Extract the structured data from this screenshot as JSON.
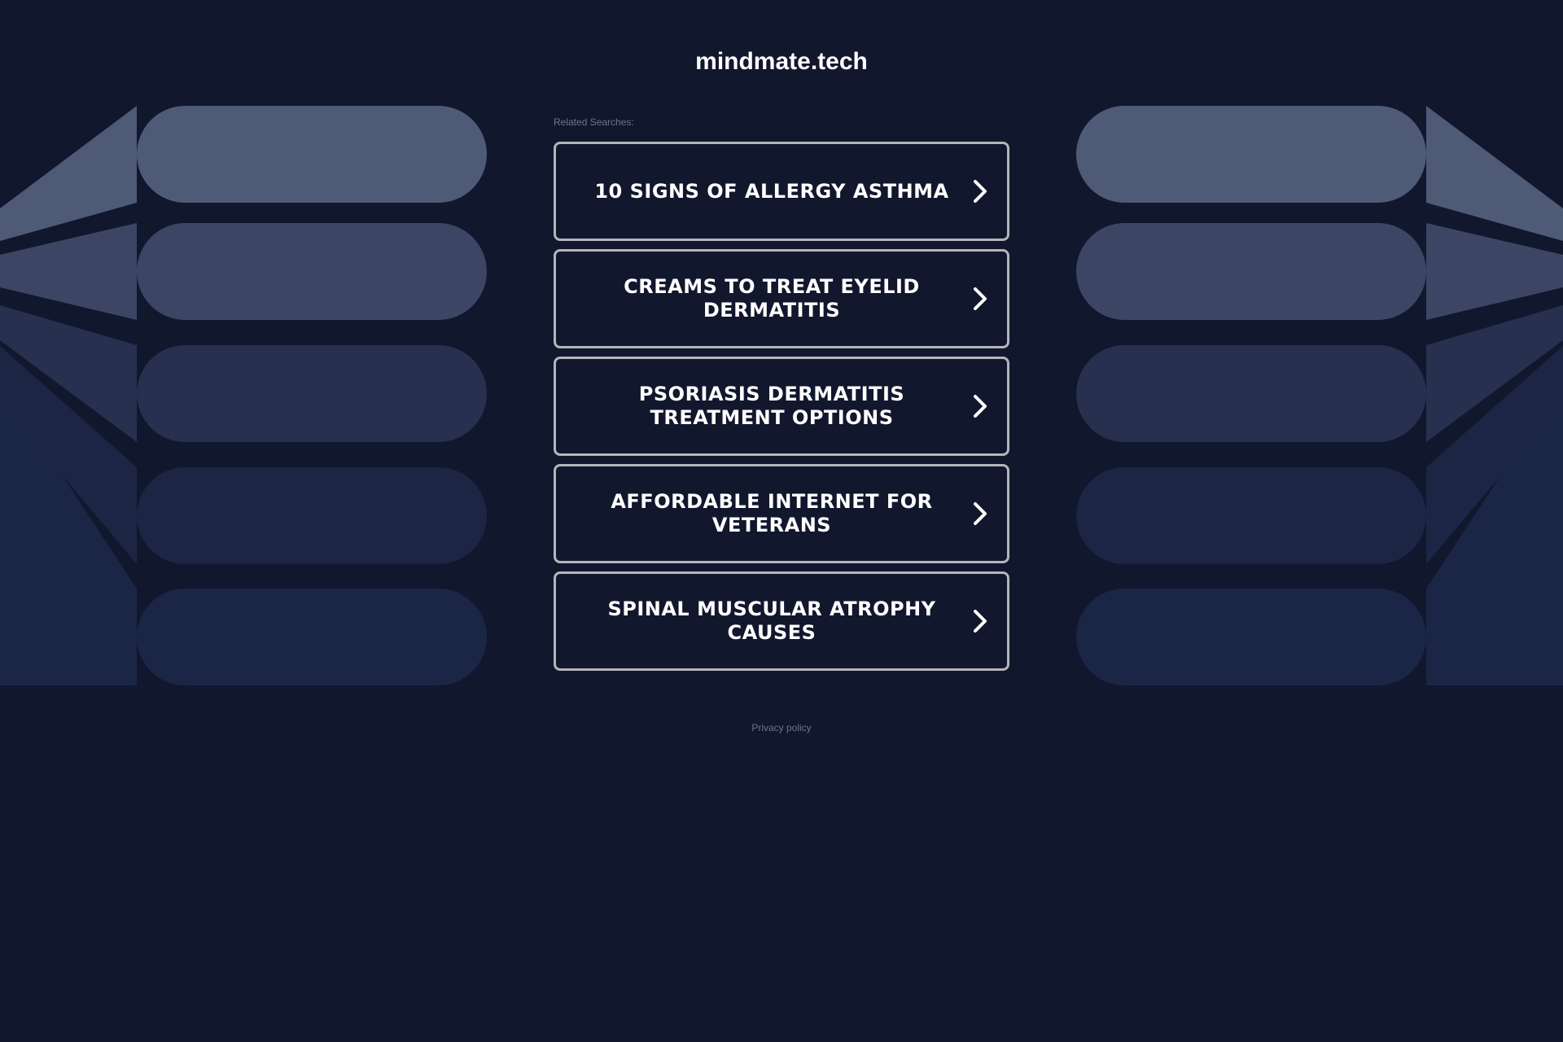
{
  "site": {
    "domain": "mindmate.tech"
  },
  "related": {
    "label": "Related Searches:",
    "items": [
      {
        "label": "10 SIGNS OF ALLERGY ASTHMA"
      },
      {
        "label": "CREAMS TO TREAT EYELID DERMATITIS"
      },
      {
        "label": "PSORIASIS DERMATITIS TREATMENT OPTIONS"
      },
      {
        "label": "AFFORDABLE INTERNET FOR VETERANS"
      },
      {
        "label": "SPINAL MUSCULAR ATROPHY CAUSES"
      }
    ]
  },
  "footer": {
    "privacy_label": "Privacy policy"
  },
  "icons": {
    "link_arrow": "chevron-right-icon"
  },
  "colors": {
    "background": "#11172d",
    "card_border": "#b3b5bb",
    "text": "#ffffff",
    "muted_text": "#6a7594",
    "band_1": "#4f5a77",
    "band_2": "#3c4664",
    "band_3": "#28304f",
    "band_4": "#1c2544",
    "band_5": "#1b2647"
  }
}
